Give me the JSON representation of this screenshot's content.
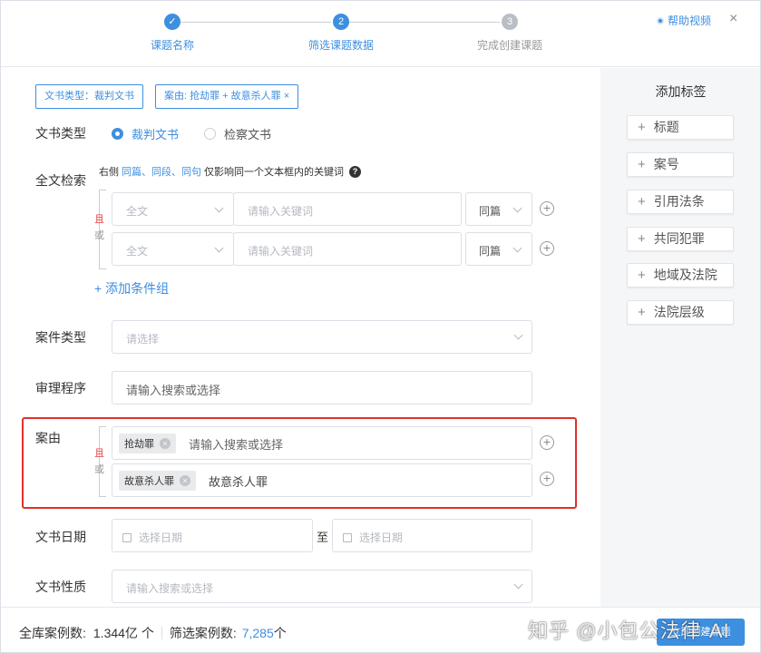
{
  "steps": [
    {
      "num": "✓",
      "label": "课题名称",
      "state": "done"
    },
    {
      "num": "2",
      "label": "筛选课题数据",
      "state": "active"
    },
    {
      "num": "3",
      "label": "完成创建课题",
      "state": "pending"
    }
  ],
  "header": {
    "help_label": "帮助视频",
    "close_glyph": "×"
  },
  "filter_chips": {
    "doc_type": "文书类型：裁判文书",
    "cause": "案由: 抢劫罪 + 故意杀人罪 ×"
  },
  "doc_type": {
    "label": "文书类型",
    "options": [
      "裁判文书",
      "检察文书"
    ],
    "selected": "裁判文书"
  },
  "fulltext": {
    "label": "全文检索",
    "hint_prefix": "右侧",
    "hint_scopes": "同篇、同段、同句",
    "hint_suffix": "仅影响同一个文本框内的关键词",
    "hint_icon": "?",
    "and_label": "且",
    "or_label": "或",
    "rows": [
      {
        "scope_placeholder": "全文",
        "keyword_placeholder": "请输入关键词",
        "range": "同篇"
      },
      {
        "scope_placeholder": "全文",
        "keyword_placeholder": "请输入关键词",
        "range": "同篇"
      }
    ],
    "add_group": "+ 添加条件组"
  },
  "case_type": {
    "label": "案件类型",
    "placeholder": "请选择"
  },
  "procedure": {
    "label": "审理程序",
    "placeholder": "请输入搜索或选择"
  },
  "cause": {
    "label": "案由",
    "and_label": "且",
    "or_label": "或",
    "rows": [
      {
        "chip": "抢劫罪",
        "input": "请输入搜索或选择"
      },
      {
        "chip": "故意杀人罪",
        "input": "故意杀人罪"
      }
    ]
  },
  "doc_date": {
    "label": "文书日期",
    "start_placeholder": "选择日期",
    "to": "至",
    "end_placeholder": "选择日期"
  },
  "doc_nature": {
    "label": "文书性质",
    "placeholder": "请输入搜索或选择"
  },
  "tag_panel": {
    "title": "添加标签",
    "items": [
      "标题",
      "案号",
      "引用法条",
      "共同犯罪",
      "地域及法院",
      "法院层级"
    ]
  },
  "footer": {
    "total_label": "全库案例数:",
    "total_value": "1.344亿 个",
    "filtered_label": "筛选案例数:",
    "filtered_value": "7,285",
    "filtered_unit": "个",
    "create_button": "立即创建课题",
    "watermark": "知乎 @小包公法律·AI"
  },
  "colors": {
    "accent": "#3d8fe0",
    "highlight": "#e0302b",
    "and": "#e33b3b"
  }
}
